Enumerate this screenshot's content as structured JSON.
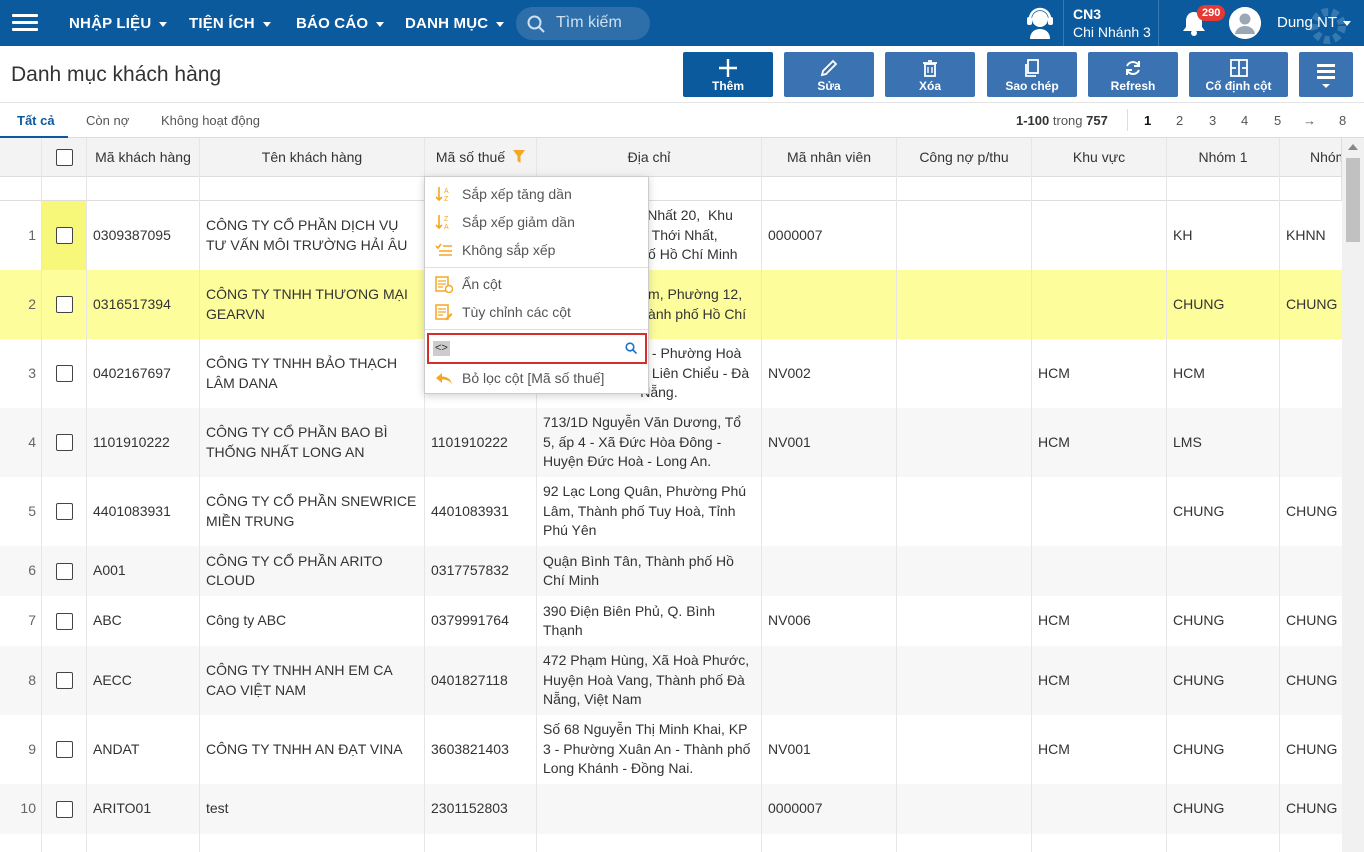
{
  "topbar": {
    "menus": [
      "NHẬP LIỆU",
      "TIỆN ÍCH",
      "BÁO CÁO",
      "DANH MỤC"
    ],
    "search_placeholder": "Tìm kiếm",
    "branch_code": "CN3",
    "branch_name": "Chi Nhánh 3",
    "notification_count": "290",
    "user_name": "Dung NT"
  },
  "page": {
    "title": "Danh mục khách hàng"
  },
  "toolbar": {
    "add": "Thêm",
    "edit": "Sửa",
    "delete": "Xóa",
    "copy": "Sao chép",
    "refresh": "Refresh",
    "freeze": "Cố định cột"
  },
  "tabs": [
    "Tất cả",
    "Còn nợ",
    "Không hoạt động"
  ],
  "pager": {
    "range": "1-100",
    "of_label": "trong",
    "total": "757",
    "pages": [
      "1",
      "2",
      "3",
      "4",
      "5"
    ],
    "next": "→",
    "last": "8"
  },
  "columns": [
    "Mã khách hàng",
    "Tên khách hàng",
    "Mã số thuế",
    "Địa chỉ",
    "Mã nhân viên",
    "Công nợ p/thu",
    "Khu vực",
    "Nhóm 1",
    "Nhóm"
  ],
  "rows": [
    {
      "n": "1",
      "code": "0309387095",
      "name": "CÔNG TY CỔ PHẦN DỊCH VỤ TƯ VẤN MÔI TRƯỜNG HẢI ÂU",
      "tax": "",
      "addr": "                         i Nhất 20,  Khu\n                         n Thới Nhất,\n                         hố Hồ Chí Minh",
      "emp": "0000007",
      "debt": "",
      "area": "",
      "g1": "KH",
      "g2": "KHNN"
    },
    {
      "n": "2",
      "code": "0316517394",
      "name": "CÔNG TY TNHH THƯƠNG MẠI GEARVN",
      "tax": "",
      "addr": "                         ám, Phường 12,\n                         hành phố Hồ Chí",
      "emp": "",
      "debt": "",
      "area": "",
      "g1": "CHUNG",
      "g2": "CHUNG"
    },
    {
      "n": "3",
      "code": "0402167697",
      "name": "CÔNG TY TNHH BẢO THẠCH LÂM DANA",
      "tax": "",
      "addr": "                         h - Phường Hoà\n                         n Liên Chiểu - Đà\n                         Nẵng.",
      "emp": "NV002",
      "debt": "",
      "area": "HCM",
      "g1": "HCM",
      "g2": ""
    },
    {
      "n": "4",
      "code": "1101910222",
      "name": "CÔNG TY CỔ PHẦN BAO BÌ THỐNG NHẤT LONG AN",
      "tax": "1101910222",
      "addr": "713/1D Nguyễn Văn Dương, Tổ 5, ấp 4 - Xã Đức Hòa Đông - Huyện Đức Hoà - Long An.",
      "emp": "NV001",
      "debt": "",
      "area": "HCM",
      "g1": "LMS",
      "g2": ""
    },
    {
      "n": "5",
      "code": "4401083931",
      "name": "CÔNG TY CỔ PHẦN SNEWRICE MIỀN TRUNG",
      "tax": "4401083931",
      "addr": "92 Lạc Long Quân, Phường Phú Lâm, Thành phố Tuy Hoà, Tỉnh Phú Yên",
      "emp": "",
      "debt": "",
      "area": "",
      "g1": "CHUNG",
      "g2": "CHUNG"
    },
    {
      "n": "6",
      "code": "A001",
      "name": "CÔNG TY CỔ PHẦN ARITO CLOUD",
      "tax": "0317757832",
      "addr": "Quận Bình Tân, Thành phố Hồ Chí Minh",
      "emp": "",
      "debt": "",
      "area": "",
      "g1": "",
      "g2": ""
    },
    {
      "n": "7",
      "code": "ABC",
      "name": "Công ty ABC",
      "tax": "0379991764",
      "addr": "390 Điện Biên Phủ, Q. Bình Thạnh",
      "emp": "NV006",
      "debt": "",
      "area": "HCM",
      "g1": "CHUNG",
      "g2": "CHUNG"
    },
    {
      "n": "8",
      "code": "AECC",
      "name": "CÔNG TY TNHH ANH EM CA CAO VIỆT NAM",
      "tax": "0401827118",
      "addr": "472 Phạm Hùng, Xã Hoà Phước, Huyện Hoà Vang, Thành phố Đà Nẵng, Việt Nam",
      "emp": "",
      "debt": "",
      "area": "HCM",
      "g1": "CHUNG",
      "g2": "CHUNG"
    },
    {
      "n": "9",
      "code": "ANDAT",
      "name": "CÔNG TY TNHH AN ĐẠT VINA",
      "tax": "3603821403",
      "addr": "Số 68 Nguyễn Thị Minh Khai, KP 3 - Phường Xuân An - Thành phố Long Khánh - Đồng Nai.",
      "emp": "NV001",
      "debt": "",
      "area": "HCM",
      "g1": "CHUNG",
      "g2": "CHUNG"
    },
    {
      "n": "10",
      "code": "ARITO01",
      "name": "test",
      "tax": "2301152803",
      "addr": "",
      "emp": "0000007",
      "debt": "",
      "area": "",
      "g1": "CHUNG",
      "g2": "CHUNG"
    }
  ],
  "column_menu": {
    "sort_asc": "Sắp xếp tăng dần",
    "sort_desc": "Sắp xếp giảm dần",
    "no_sort": "Không sắp xếp",
    "hide_column": "Ẩn cột",
    "customize_columns": "Tùy chỉnh các cột",
    "filter_operator": "<>",
    "filter_value": "",
    "clear_filter": "Bỏ lọc cột [Mã số thuế]"
  }
}
